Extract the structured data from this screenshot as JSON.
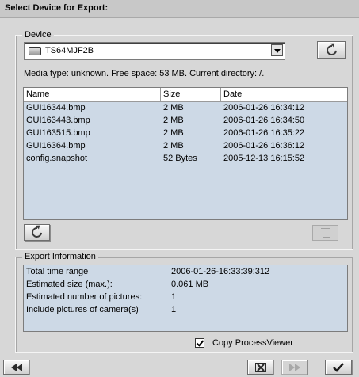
{
  "window": {
    "title": "Select Device for Export:"
  },
  "device": {
    "group_title": "Device",
    "selected_device": "TS64MJF2B",
    "media_info": "Media type: unknown. Free space: 53 MB. Current directory: /."
  },
  "files": {
    "columns": [
      "Name",
      "Size",
      "Date"
    ],
    "rows": [
      {
        "name": "GUI16344.bmp",
        "size": "2 MB",
        "date": "2006-01-26 16:34:12"
      },
      {
        "name": "GUI163443.bmp",
        "size": "2 MB",
        "date": "2006-01-26 16:34:50"
      },
      {
        "name": "GUI163515.bmp",
        "size": "2 MB",
        "date": "2006-01-26 16:35:22"
      },
      {
        "name": "GUI16364.bmp",
        "size": "2 MB",
        "date": "2006-01-26 16:36:12"
      },
      {
        "name": "config.snapshot",
        "size": "52 Bytes",
        "date": "2005-12-13 16:15:52"
      }
    ]
  },
  "export": {
    "group_title": "Export Information",
    "rows": [
      {
        "label": "Total time range",
        "value": "2006-01-26-16:33:39:312"
      },
      {
        "label": "Estimated size (max.):",
        "value": "0.061 MB"
      },
      {
        "label": "Estimated number of pictures:",
        "value": "1"
      },
      {
        "label": "Include pictures of camera(s)",
        "value": "1"
      }
    ],
    "copy_processviewer_label": "Copy ProcessViewer",
    "copy_processviewer_checked": true
  },
  "icons": {
    "refresh_device": "refresh-icon",
    "refresh_list": "refresh-icon",
    "delete": "trash-icon",
    "back": "rewind-icon",
    "cancel": "cancel-icon",
    "forward": "fast-forward-icon",
    "ok": "checkmark-icon"
  }
}
